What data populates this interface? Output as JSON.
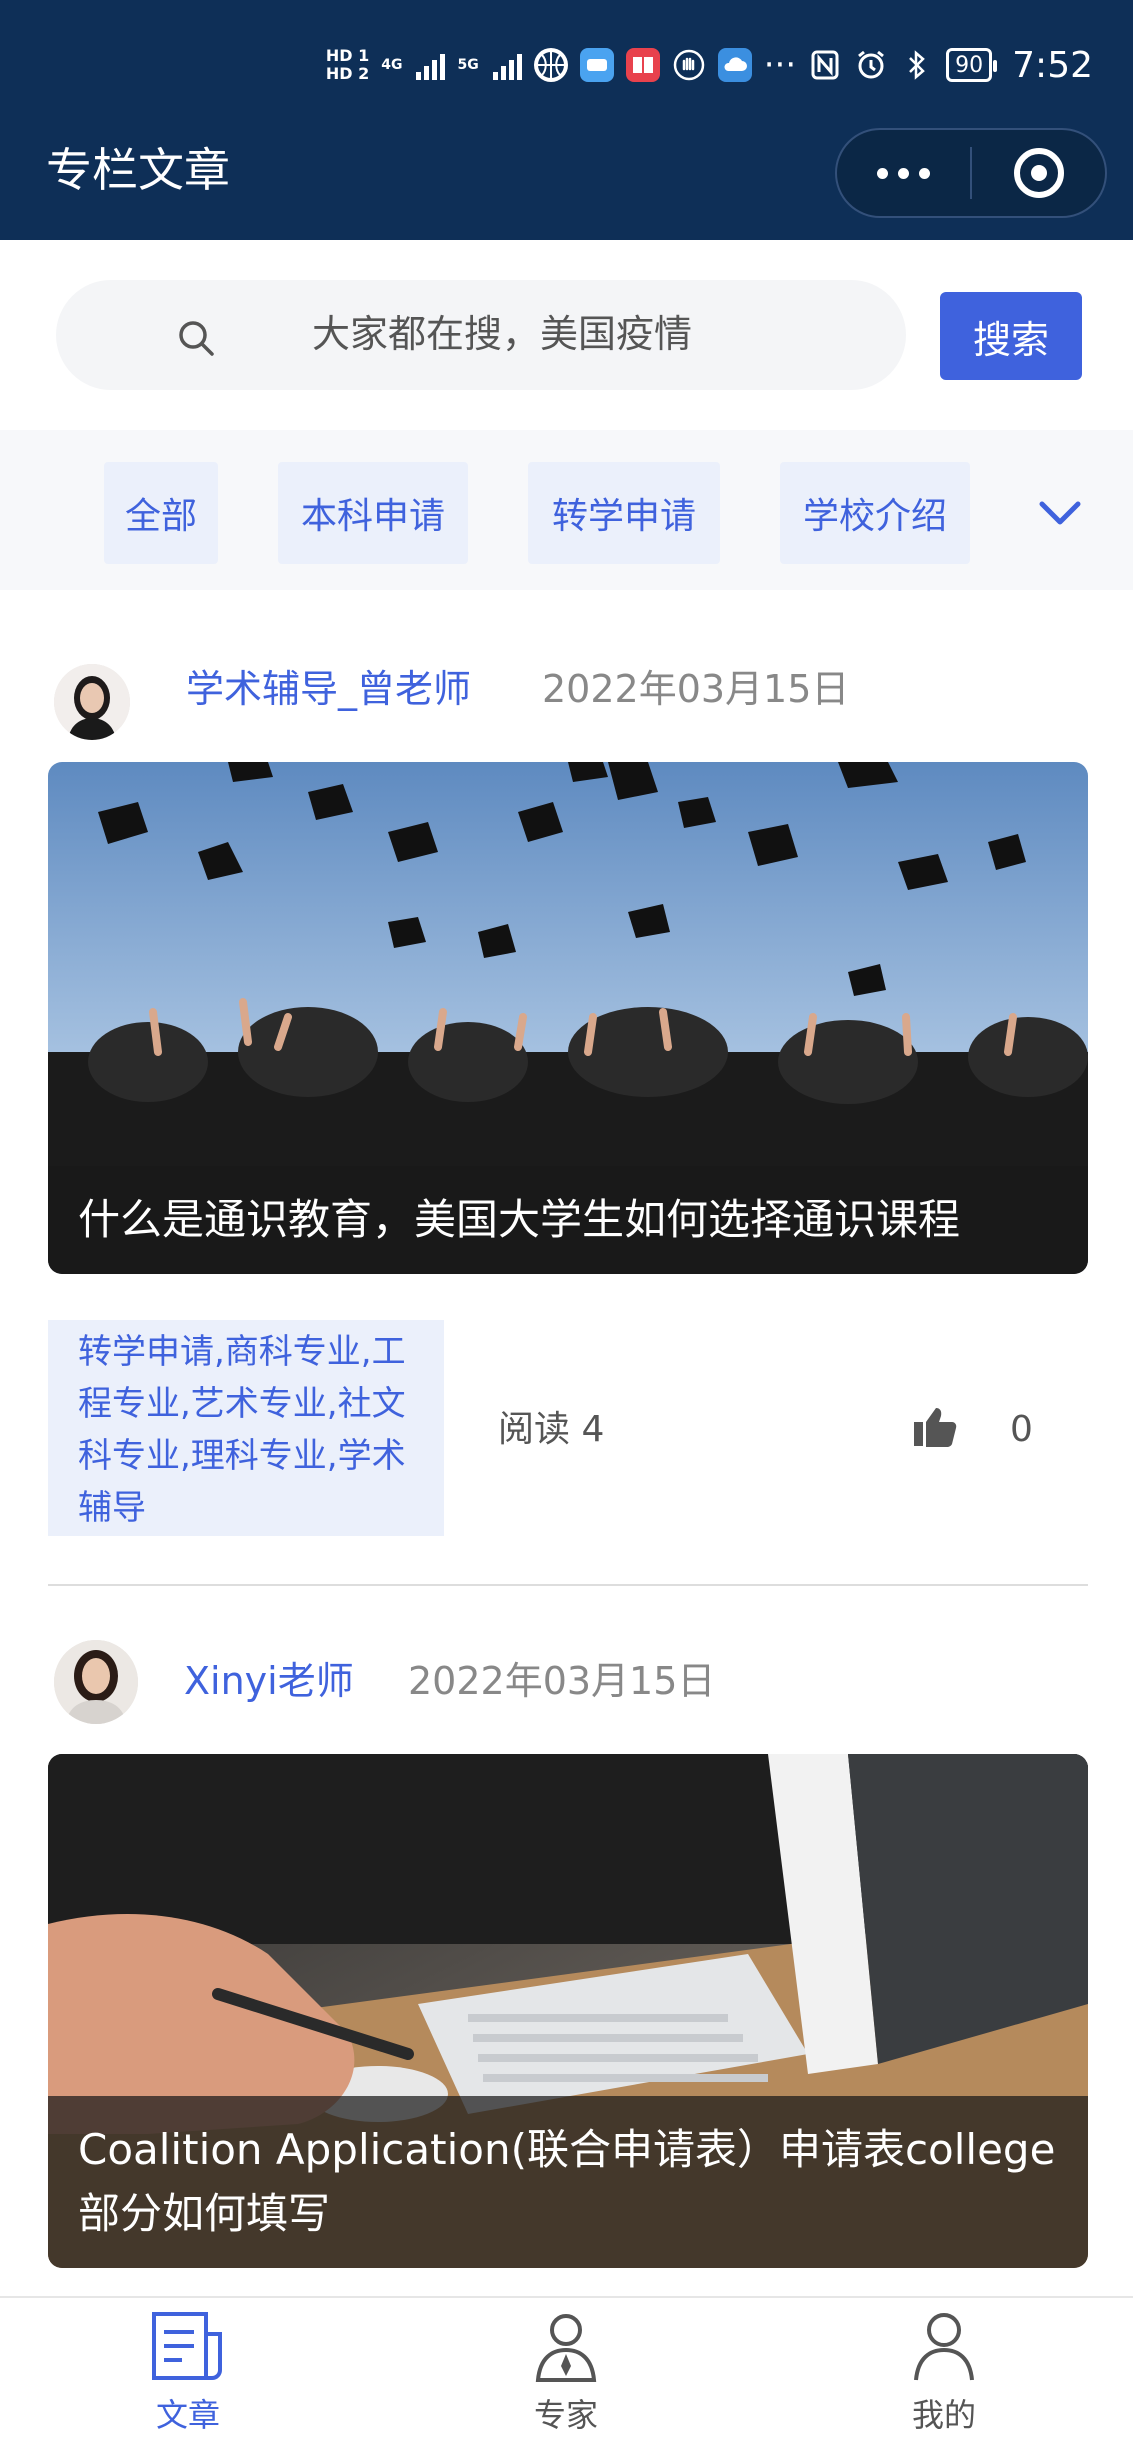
{
  "status_bar": {
    "time": "7:52",
    "network": "4G",
    "network2": "5G",
    "battery": "90"
  },
  "header": {
    "title": "专栏文章"
  },
  "search": {
    "placeholder": "大家都在搜，美国疫情",
    "button_label": "搜索"
  },
  "categories": {
    "items": [
      "全部",
      "本科申请",
      "转学申请",
      "学校介绍"
    ]
  },
  "articles": [
    {
      "author": "学术辅导_曾老师",
      "date": "2022年03月15日",
      "title": "什么是通识教育，美国大学生如何选择通识课程",
      "tags": "转学申请,商科专业,工程专业,艺术专业,社文科专业,理科专业,学术辅导",
      "reads": "阅读 4",
      "likes": "0"
    },
    {
      "author": "Xinyi老师",
      "date": "2022年03月15日",
      "title": "Coalition Application(联合申请表）申请表college部分如何填写"
    }
  ],
  "bottom_nav": {
    "items": [
      {
        "label": "文章",
        "icon": "article-icon",
        "active": true
      },
      {
        "label": "专家",
        "icon": "expert-icon",
        "active": false
      },
      {
        "label": "我的",
        "icon": "profile-icon",
        "active": false
      }
    ]
  },
  "colors": {
    "header_bg": "#0e2f57",
    "accent": "#3f62dd",
    "tag_bg": "#ebf0fb"
  }
}
